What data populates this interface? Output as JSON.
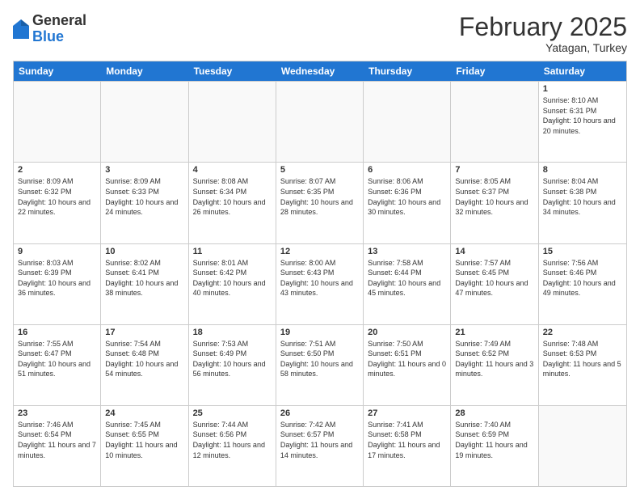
{
  "header": {
    "logo": {
      "line1": "General",
      "line2": "Blue"
    },
    "title": "February 2025",
    "subtitle": "Yatagan, Turkey"
  },
  "days": [
    "Sunday",
    "Monday",
    "Tuesday",
    "Wednesday",
    "Thursday",
    "Friday",
    "Saturday"
  ],
  "weeks": [
    [
      {
        "day": "",
        "info": ""
      },
      {
        "day": "",
        "info": ""
      },
      {
        "day": "",
        "info": ""
      },
      {
        "day": "",
        "info": ""
      },
      {
        "day": "",
        "info": ""
      },
      {
        "day": "",
        "info": ""
      },
      {
        "day": "1",
        "info": "Sunrise: 8:10 AM\nSunset: 6:31 PM\nDaylight: 10 hours and 20 minutes."
      }
    ],
    [
      {
        "day": "2",
        "info": "Sunrise: 8:09 AM\nSunset: 6:32 PM\nDaylight: 10 hours and 22 minutes."
      },
      {
        "day": "3",
        "info": "Sunrise: 8:09 AM\nSunset: 6:33 PM\nDaylight: 10 hours and 24 minutes."
      },
      {
        "day": "4",
        "info": "Sunrise: 8:08 AM\nSunset: 6:34 PM\nDaylight: 10 hours and 26 minutes."
      },
      {
        "day": "5",
        "info": "Sunrise: 8:07 AM\nSunset: 6:35 PM\nDaylight: 10 hours and 28 minutes."
      },
      {
        "day": "6",
        "info": "Sunrise: 8:06 AM\nSunset: 6:36 PM\nDaylight: 10 hours and 30 minutes."
      },
      {
        "day": "7",
        "info": "Sunrise: 8:05 AM\nSunset: 6:37 PM\nDaylight: 10 hours and 32 minutes."
      },
      {
        "day": "8",
        "info": "Sunrise: 8:04 AM\nSunset: 6:38 PM\nDaylight: 10 hours and 34 minutes."
      }
    ],
    [
      {
        "day": "9",
        "info": "Sunrise: 8:03 AM\nSunset: 6:39 PM\nDaylight: 10 hours and 36 minutes."
      },
      {
        "day": "10",
        "info": "Sunrise: 8:02 AM\nSunset: 6:41 PM\nDaylight: 10 hours and 38 minutes."
      },
      {
        "day": "11",
        "info": "Sunrise: 8:01 AM\nSunset: 6:42 PM\nDaylight: 10 hours and 40 minutes."
      },
      {
        "day": "12",
        "info": "Sunrise: 8:00 AM\nSunset: 6:43 PM\nDaylight: 10 hours and 43 minutes."
      },
      {
        "day": "13",
        "info": "Sunrise: 7:58 AM\nSunset: 6:44 PM\nDaylight: 10 hours and 45 minutes."
      },
      {
        "day": "14",
        "info": "Sunrise: 7:57 AM\nSunset: 6:45 PM\nDaylight: 10 hours and 47 minutes."
      },
      {
        "day": "15",
        "info": "Sunrise: 7:56 AM\nSunset: 6:46 PM\nDaylight: 10 hours and 49 minutes."
      }
    ],
    [
      {
        "day": "16",
        "info": "Sunrise: 7:55 AM\nSunset: 6:47 PM\nDaylight: 10 hours and 51 minutes."
      },
      {
        "day": "17",
        "info": "Sunrise: 7:54 AM\nSunset: 6:48 PM\nDaylight: 10 hours and 54 minutes."
      },
      {
        "day": "18",
        "info": "Sunrise: 7:53 AM\nSunset: 6:49 PM\nDaylight: 10 hours and 56 minutes."
      },
      {
        "day": "19",
        "info": "Sunrise: 7:51 AM\nSunset: 6:50 PM\nDaylight: 10 hours and 58 minutes."
      },
      {
        "day": "20",
        "info": "Sunrise: 7:50 AM\nSunset: 6:51 PM\nDaylight: 11 hours and 0 minutes."
      },
      {
        "day": "21",
        "info": "Sunrise: 7:49 AM\nSunset: 6:52 PM\nDaylight: 11 hours and 3 minutes."
      },
      {
        "day": "22",
        "info": "Sunrise: 7:48 AM\nSunset: 6:53 PM\nDaylight: 11 hours and 5 minutes."
      }
    ],
    [
      {
        "day": "23",
        "info": "Sunrise: 7:46 AM\nSunset: 6:54 PM\nDaylight: 11 hours and 7 minutes."
      },
      {
        "day": "24",
        "info": "Sunrise: 7:45 AM\nSunset: 6:55 PM\nDaylight: 11 hours and 10 minutes."
      },
      {
        "day": "25",
        "info": "Sunrise: 7:44 AM\nSunset: 6:56 PM\nDaylight: 11 hours and 12 minutes."
      },
      {
        "day": "26",
        "info": "Sunrise: 7:42 AM\nSunset: 6:57 PM\nDaylight: 11 hours and 14 minutes."
      },
      {
        "day": "27",
        "info": "Sunrise: 7:41 AM\nSunset: 6:58 PM\nDaylight: 11 hours and 17 minutes."
      },
      {
        "day": "28",
        "info": "Sunrise: 7:40 AM\nSunset: 6:59 PM\nDaylight: 11 hours and 19 minutes."
      },
      {
        "day": "",
        "info": ""
      }
    ]
  ]
}
